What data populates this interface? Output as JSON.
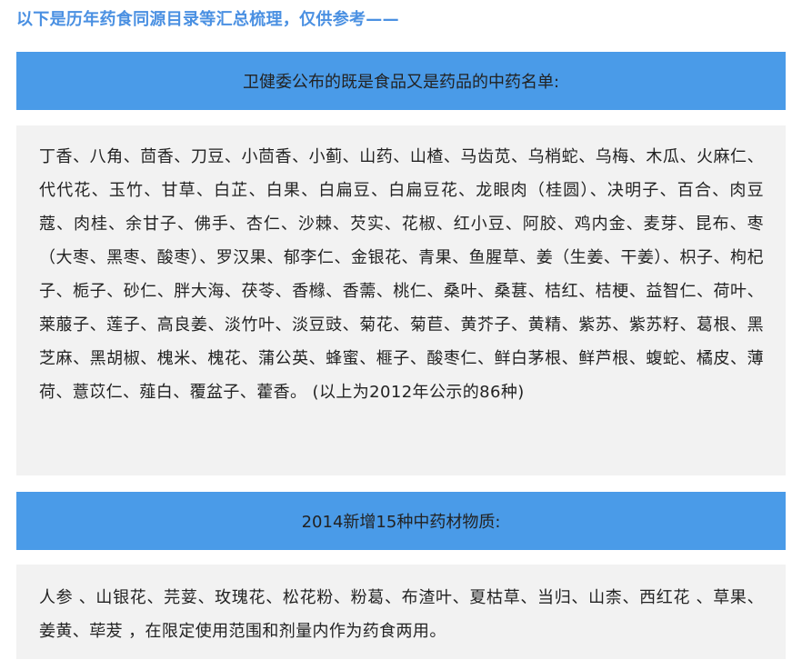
{
  "intro": "以下是历年药食同源目录等汇总梳理，仅供参考——",
  "section1": {
    "heading": "卫健委公布的既是食品又是药品的中药名单:",
    "body": "丁香、八角、茴香、刀豆、小茴香、小蓟、山药、山楂、马齿苋、乌梢蛇、乌梅、木瓜、火麻仁、代代花、玉竹、甘草、白芷、白果、白扁豆、白扁豆花、龙眼肉（桂圆）、决明子、百合、肉豆蔻、肉桂、余甘子、佛手、杏仁、沙棘、芡实、花椒、红小豆、阿胶、鸡内金、麦芽、昆布、枣（大枣、黑枣、酸枣）、罗汉果、郁李仁、金银花、青果、鱼腥草、姜（生姜、干姜）、枳子、枸杞子、栀子、砂仁、胖大海、茯苓、香橼、香薷、桃仁、桑叶、桑葚、桔红、桔梗、益智仁、荷叶、莱菔子、莲子、高良姜、淡竹叶、淡豆豉、菊花、菊苣、黄芥子、黄精、紫苏、紫苏籽、葛根、黑芝麻、黑胡椒、槐米、槐花、蒲公英、蜂蜜、榧子、酸枣仁、鲜白茅根、鲜芦根、蝮蛇、橘皮、薄荷、薏苡仁、薤白、覆盆子、藿香。 (以上为2012年公示的86种)"
  },
  "section2": {
    "heading": "2014新增15种中药材物质:",
    "body": "人参 、山银花、芫荽、玫瑰花、松花粉、粉葛、布渣叶、夏枯草、当归、山柰、西红花 、草果、姜黄、荜茇 ，在限定使用范围和剂量内作为药食两用。"
  }
}
